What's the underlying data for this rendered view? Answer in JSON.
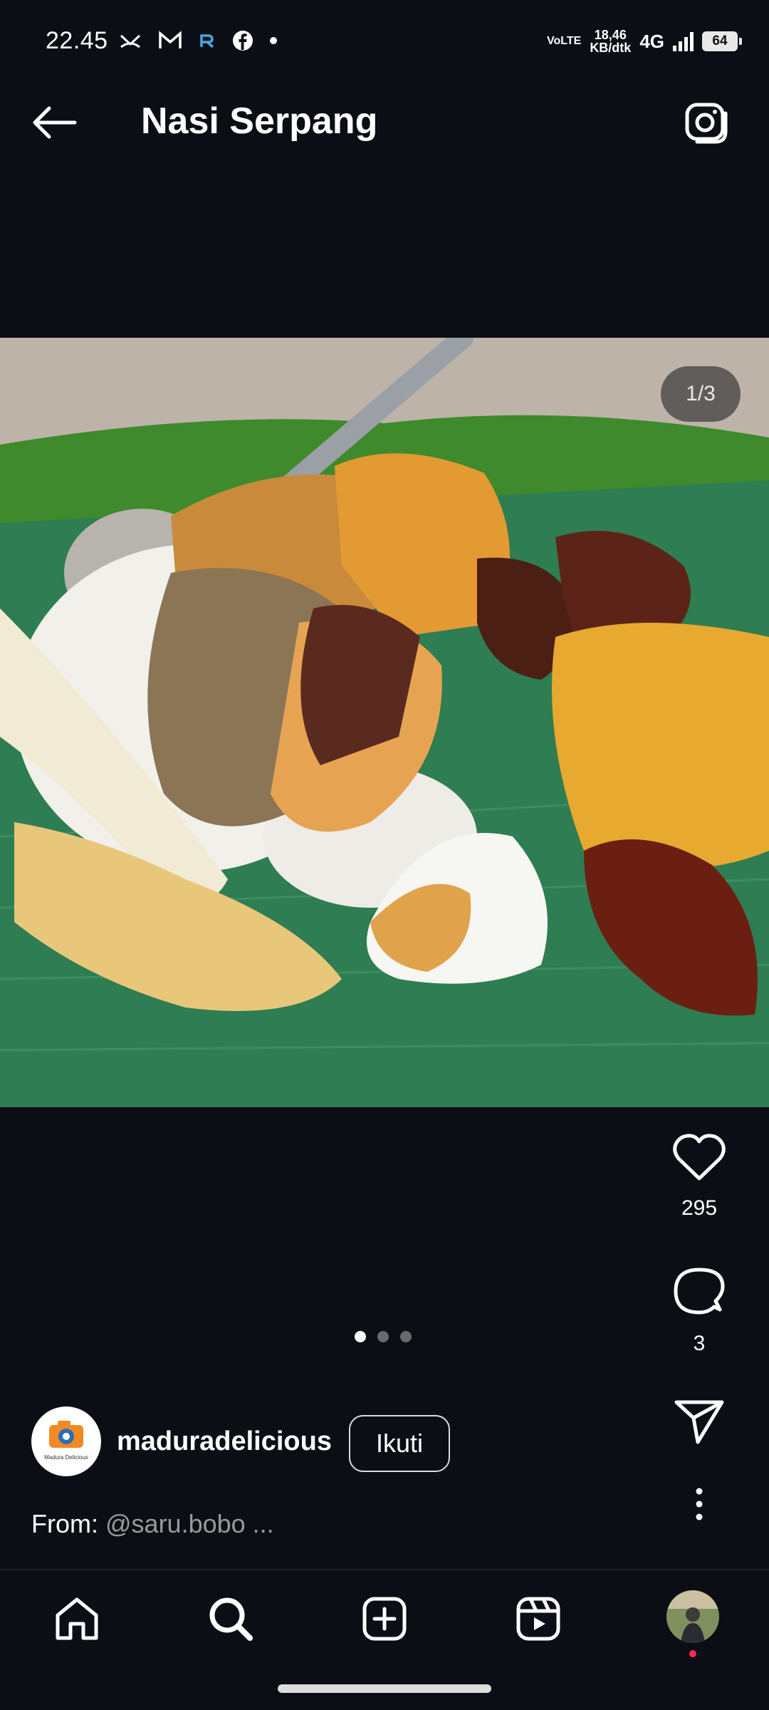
{
  "status_bar": {
    "time": "22.45",
    "volte": "VoLTE",
    "speed_value": "18,46",
    "speed_unit": "KB/dtk",
    "network": "4G",
    "battery": "64"
  },
  "header": {
    "title": "Nasi Serpang"
  },
  "post": {
    "image_counter": "1/3",
    "likes": "295",
    "comments": "3",
    "carousel_total": 3,
    "carousel_active": 1,
    "author": "maduradelicious",
    "follow_label": "Ikuti",
    "caption_prefix": "From: ",
    "caption_handle": "@saru.bobo ...",
    "avatar_text": "Madura Delicious"
  },
  "icons": {
    "back": "arrow-left-icon",
    "camera": "camera-icon",
    "like": "heart-icon",
    "comment": "comment-icon",
    "share": "send-icon",
    "more": "more-vertical-icon",
    "home": "home-icon",
    "search": "search-icon",
    "create": "plus-square-icon",
    "reels": "reels-icon"
  },
  "colors": {
    "background": "#0b0e14",
    "leaf": "#2f7d4f",
    "notification": "#ff2d55"
  }
}
